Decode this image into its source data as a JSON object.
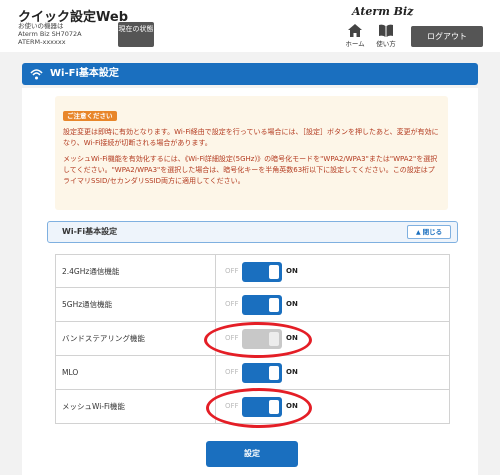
{
  "header": {
    "app_title": "クイック設定Web",
    "device_caption": "お使いの機器は",
    "device_model": "Aterm Biz SH7072A",
    "device_ssid": "ATERM-xxxxxx",
    "status_button": "現在の状態",
    "brand": "Aterm Biz",
    "nav_home": "ホーム",
    "nav_manual": "使い方",
    "logout_button": "ログアウト"
  },
  "page": {
    "title": "Wi-Fi基本設定"
  },
  "notice": {
    "badge": "ご注意ください",
    "paragraph1": "設定変更は即時に有効となります。Wi-Fi経由で設定を行っている場合には、［設定］ボタンを押したあと、変更が有効になり、Wi-Fi接続が切断される場合があります。",
    "paragraph2": "メッシュWi-Fi機能を有効化するには、《Wi-Fi詳細設定(5GHz)》の暗号化モードを\"WPA2/WPA3\"または\"WPA2\"を選択してください。\"WPA2/WPA3\"を選択した場合は、暗号化キーを半角英数63桁以下に設定してください。この設定はプライマリSSID/セカンダリSSID両方に適用してください。"
  },
  "section": {
    "title": "Wi-Fi基本設定",
    "close_button": "閉じる"
  },
  "settings": {
    "rows": [
      {
        "label": "2.4GHz通信機能",
        "off": "OFF",
        "on": "ON",
        "state": "on",
        "enabled": true
      },
      {
        "label": "5GHz通信機能",
        "off": "OFF",
        "on": "ON",
        "state": "on",
        "enabled": true
      },
      {
        "label": "バンドステアリング機能",
        "off": "OFF",
        "on": "ON",
        "state": "on",
        "enabled": false
      },
      {
        "label": "MLO",
        "off": "OFF",
        "on": "ON",
        "state": "on",
        "enabled": true
      },
      {
        "label": "メッシュWi-Fi機能",
        "off": "OFF",
        "on": "ON",
        "state": "on",
        "enabled": true
      }
    ]
  },
  "submit_button": "設定",
  "colors": {
    "accent_blue": "#1a6fbf",
    "notice_text": "#b33a1f",
    "annotation_red": "#e41e26"
  }
}
